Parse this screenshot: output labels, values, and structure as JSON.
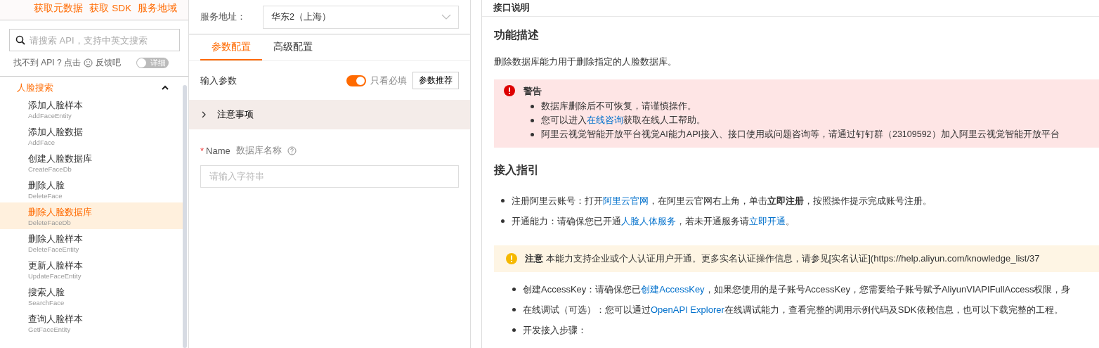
{
  "sidebar": {
    "top_links": [
      "获取元数据",
      "获取 SDK",
      "服务地域"
    ],
    "search": {
      "placeholder": "请搜索 API，支持中英文搜索"
    },
    "feedback": {
      "before": "找不到 API ? 点击",
      "after": "反馈吧"
    },
    "detail_toggle": {
      "label": "详细",
      "on": false
    },
    "group": {
      "label": "人脸搜索",
      "expanded": true,
      "items": [
        {
          "title": "添加人脸样本",
          "api": "AddFaceEntity",
          "selected": false
        },
        {
          "title": "添加人脸数据",
          "api": "AddFace",
          "selected": false
        },
        {
          "title": "创建人脸数据库",
          "api": "CreateFaceDb",
          "selected": false
        },
        {
          "title": "删除人脸",
          "api": "DeleteFace",
          "selected": false
        },
        {
          "title": "删除人脸数据库",
          "api": "DeleteFaceDb",
          "selected": true
        },
        {
          "title": "删除人脸样本",
          "api": "DeleteFaceEntity",
          "selected": false
        },
        {
          "title": "更新人脸样本",
          "api": "UpdateFaceEntity",
          "selected": false
        },
        {
          "title": "搜索人脸",
          "api": "SearchFace",
          "selected": false
        },
        {
          "title": "查询人脸样本",
          "api": "GetFaceEntity",
          "selected": false
        }
      ]
    }
  },
  "params": {
    "service": {
      "label": "服务地址：",
      "value": "华东2（上海）"
    },
    "tabs": [
      {
        "label": "参数配置",
        "selected": true
      },
      {
        "label": "高级配置",
        "selected": false
      }
    ],
    "input_label": "输入参数",
    "required_only": {
      "label": "只看必填",
      "on": true
    },
    "recommend_button": "参数推荐",
    "notes": {
      "label": "注意事项",
      "expanded": false
    },
    "fields": [
      {
        "name": "Name",
        "required_mark": "*",
        "description": "数据库名称",
        "placeholder": "请输入字符串"
      }
    ]
  },
  "docs": {
    "title": "接口说明",
    "sections": [
      {
        "kind": "heading",
        "text": "功能描述"
      },
      {
        "kind": "paragraph",
        "parts": [
          {
            "kind": "plain",
            "text": "删除数据库能力用于删除指定的人脸数据库。"
          }
        ]
      },
      {
        "kind": "warning",
        "title": "警告",
        "bullets": [
          [
            {
              "kind": "plain",
              "text": "数据库删除后不可恢复，请谨慎操作。"
            }
          ],
          [
            {
              "kind": "plain",
              "text": "您可以进入"
            },
            {
              "kind": "link",
              "text": "在线咨询"
            },
            {
              "kind": "plain",
              "text": "获取在线人工帮助。"
            }
          ],
          [
            {
              "kind": "plain",
              "text": "阿里云视觉智能开放平台视觉AI能力API接入、接口使用或问题咨询等，请通过钉钉群（23109592）加入阿里云视觉智能开放平台"
            }
          ]
        ]
      },
      {
        "kind": "heading",
        "text": "接入指引"
      },
      {
        "kind": "bullets",
        "bullets": [
          [
            {
              "kind": "plain",
              "text": "注册阿里云账号：打开"
            },
            {
              "kind": "link",
              "text": "阿里云官网"
            },
            {
              "kind": "plain",
              "text": "，在阿里云官网右上角，单击"
            },
            {
              "kind": "bold",
              "text": "立即注册"
            },
            {
              "kind": "plain",
              "text": "，按照操作提示完成账号注册。"
            }
          ],
          [
            {
              "kind": "plain",
              "text": "开通能力：请确保您已开通"
            },
            {
              "kind": "link",
              "text": "人脸人体服务"
            },
            {
              "kind": "plain",
              "text": "，若未开通服务请"
            },
            {
              "kind": "link",
              "text": "立即开通"
            },
            {
              "kind": "plain",
              "text": "。"
            }
          ]
        ]
      },
      {
        "kind": "notice",
        "parts": [
          {
            "kind": "bold",
            "text": "注意"
          },
          {
            "kind": "plain",
            "text": " 本能力支持企业或个人认证用户开通。更多实名认证操作信息，请参见[实名认证](https://help.aliyun.com/knowledge_list/37"
          }
        ]
      },
      {
        "kind": "bullets",
        "bullets": [
          [
            {
              "kind": "plain",
              "text": "创建AccessKey：请确保您已"
            },
            {
              "kind": "link",
              "text": "创建AccessKey"
            },
            {
              "kind": "plain",
              "text": "，如果您使用的是子账号AccessKey，您需要给子账号赋予AliyunVIAPIFullAccess权限，身"
            }
          ],
          [
            {
              "kind": "plain",
              "text": "在线调试（可选）：您可以通过"
            },
            {
              "kind": "link",
              "text": "OpenAPI Explorer"
            },
            {
              "kind": "plain",
              "text": "在线调试能力，查看完整的调用示例代码及SDK依赖信息，也可以下载完整的工程。"
            }
          ],
          [
            {
              "kind": "plain",
              "text": "开发接入步骤："
            }
          ]
        ]
      }
    ]
  }
}
